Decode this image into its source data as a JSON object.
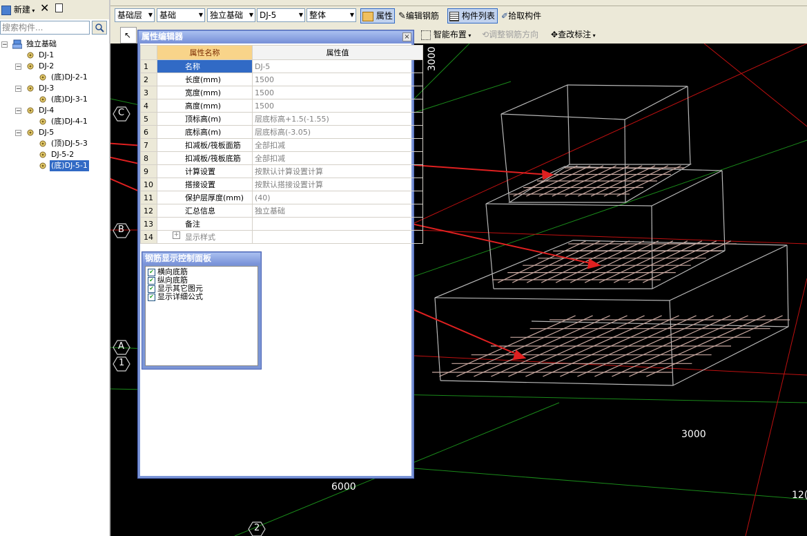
{
  "left_panel": {
    "new_label": "新建",
    "search_placeholder": "搜索构件...",
    "tree": {
      "root": "独立基础",
      "items": [
        {
          "label": "DJ-1",
          "level": 1,
          "expandable": false
        },
        {
          "label": "DJ-2",
          "level": 1,
          "expandable": true
        },
        {
          "label": "(底)DJ-2-1",
          "level": 2,
          "expandable": false
        },
        {
          "label": "DJ-3",
          "level": 1,
          "expandable": true
        },
        {
          "label": "(底)DJ-3-1",
          "level": 2,
          "expandable": false
        },
        {
          "label": "DJ-4",
          "level": 1,
          "expandable": true
        },
        {
          "label": "(底)DJ-4-1",
          "level": 2,
          "expandable": false
        },
        {
          "label": "DJ-5",
          "level": 1,
          "expandable": true
        },
        {
          "label": "(顶)DJ-5-3",
          "level": 2,
          "expandable": false
        },
        {
          "label": "DJ-5-2",
          "level": 2,
          "expandable": false
        },
        {
          "label": "(底)DJ-5-1",
          "level": 2,
          "expandable": false,
          "selected": true
        }
      ]
    }
  },
  "toolbar": {
    "floor_combo": "基础层",
    "category_combo": "基础",
    "type_combo": "独立基础",
    "element_combo": "DJ-5",
    "scope_combo": "整体",
    "property_btn": "属性",
    "edit_rebar_btn": "编辑钢筋",
    "component_list_btn": "构件列表",
    "pick_component_btn": "拾取构件",
    "smart_layout_btn": "智能布置",
    "adjust_rebar_dir_btn": "调整钢筋方向",
    "modify_annotation_btn": "查改标注"
  },
  "property_editor": {
    "title": "属性编辑器",
    "close_label": "×",
    "col_name": "属性名称",
    "col_value": "属性值",
    "rows": [
      {
        "num": "1",
        "name": "名称",
        "value": "DJ-5"
      },
      {
        "num": "2",
        "name": "长度(mm)",
        "value": "1500"
      },
      {
        "num": "3",
        "name": "宽度(mm)",
        "value": "1500"
      },
      {
        "num": "4",
        "name": "高度(mm)",
        "value": "1500"
      },
      {
        "num": "5",
        "name": "顶标高(m)",
        "value": "层底标高+1.5(-1.55)"
      },
      {
        "num": "6",
        "name": "底标高(m)",
        "value": "层底标高(-3.05)"
      },
      {
        "num": "7",
        "name": "扣减板/筏板面筋",
        "value": "全部扣减"
      },
      {
        "num": "8",
        "name": "扣减板/筏板底筋",
        "value": "全部扣减"
      },
      {
        "num": "9",
        "name": "计算设置",
        "value": "按默认计算设置计算"
      },
      {
        "num": "10",
        "name": "搭接设置",
        "value": "按默认搭接设置计算"
      },
      {
        "num": "11",
        "name": "保护层厚度(mm)",
        "value": "(40)"
      },
      {
        "num": "12",
        "name": "汇总信息",
        "value": "独立基础"
      },
      {
        "num": "13",
        "name": "备注",
        "value": ""
      },
      {
        "num": "14",
        "name": "显示样式",
        "value": ""
      }
    ]
  },
  "rebar_panel": {
    "title": "钢筋显示控制面板",
    "options": [
      "横向底筋",
      "纵向底筋",
      "显示其它图元",
      "显示详细公式"
    ]
  },
  "canvas": {
    "labels": {
      "dim_top": "3000",
      "dim_right": "3000",
      "dim_bottom": "6000",
      "dim_corner": "12("
    },
    "axes": {
      "C": "C",
      "B": "B",
      "A": "A",
      "one": "1",
      "two": "2"
    }
  }
}
